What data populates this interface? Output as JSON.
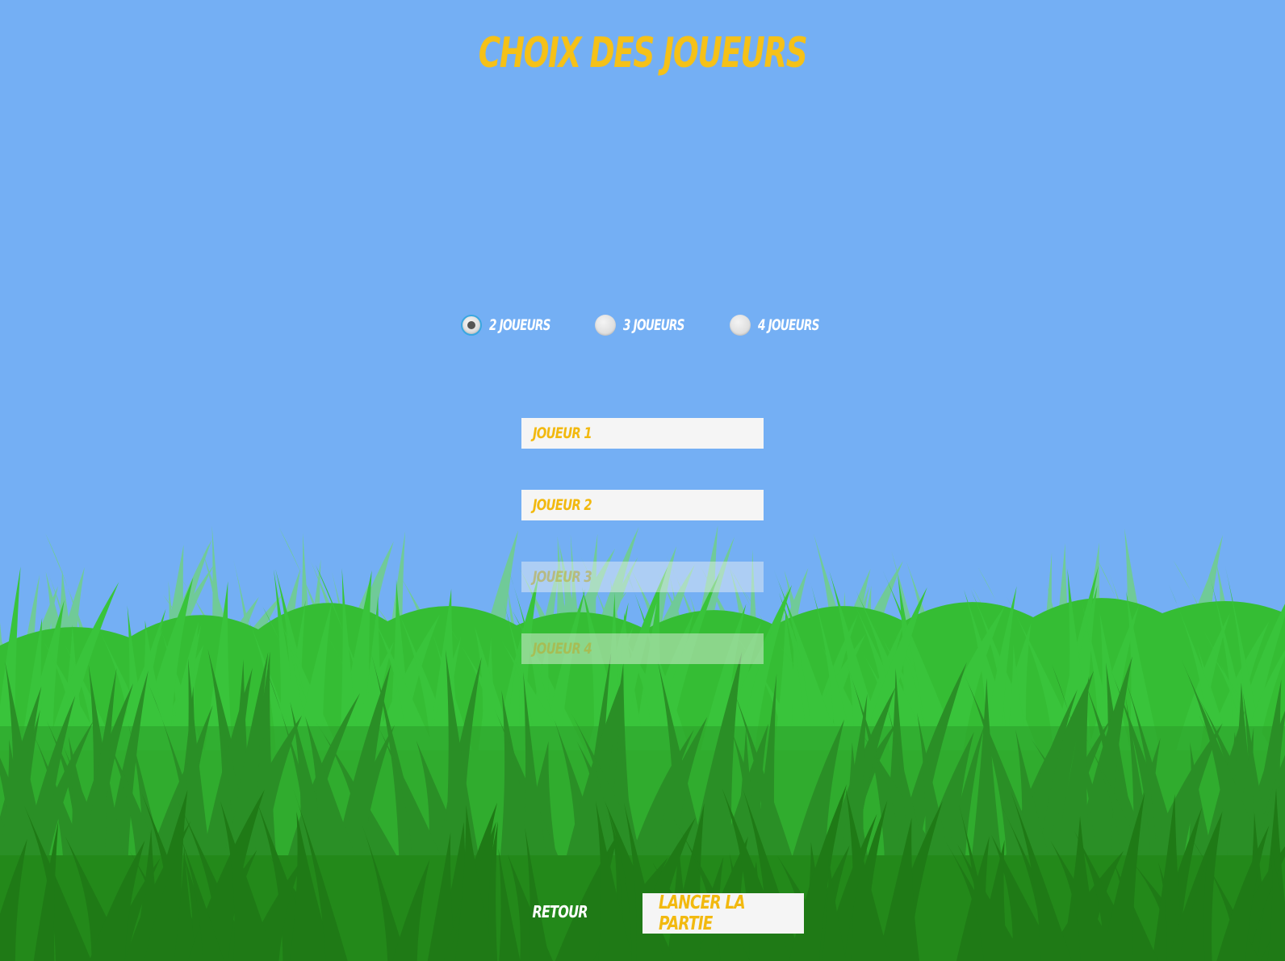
{
  "screen": {
    "title": "CHOIX DES JOUEURS"
  },
  "player_count": {
    "selected": "2 JOUEURS",
    "options": [
      {
        "label": "2 JOUEURS",
        "checked": true
      },
      {
        "label": "3 JOUEURS",
        "checked": false
      },
      {
        "label": "4 JOUEURS",
        "checked": false
      }
    ]
  },
  "players": [
    {
      "placeholder": "JOUEUR 1",
      "enabled": true
    },
    {
      "placeholder": "JOUEUR 2",
      "enabled": true
    },
    {
      "placeholder": "JOUEUR 3",
      "enabled": false
    },
    {
      "placeholder": "JOUEUR 4",
      "enabled": false
    }
  ],
  "actions": {
    "back_label": "RETOUR",
    "launch_label": "LANCER LA PARTIE"
  },
  "colors": {
    "sky": "#74aff4",
    "accent": "#f5c118",
    "grass_light": "#33bb33",
    "grass_dark": "#1f7d14"
  }
}
